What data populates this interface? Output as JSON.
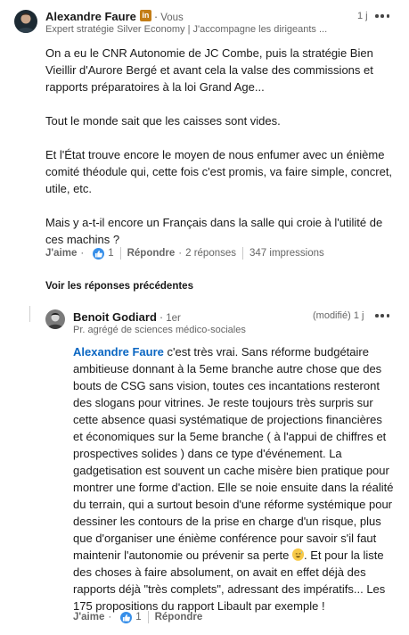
{
  "comment": {
    "author": "Alexandre Faure",
    "badge_letters": "in",
    "relation": "Vous",
    "headline": "Expert stratégie Silver Economy | J'accompagne les dirigeants ...",
    "time": "1 j",
    "paragraphs": [
      "On a eu le CNR Autonomie de JC Combe, puis la stratégie Bien Vieillir d'Aurore Bergé et avant cela la valse des commissions et rapports préparatoires à la loi Grand Age...",
      "Tout le monde sait que les caisses sont vides.",
      "Et l'État trouve encore le moyen de nous enfumer avec un énième comité théodule qui, cette fois c'est promis, va faire simple, concret, utile, etc.",
      "Mais y a-t-il encore un Français dans la salle qui croie à l'utilité de ces machins ?"
    ],
    "like_label": "J'aime",
    "like_count": "1",
    "reply_label": "Répondre",
    "replies_count": "2 réponses",
    "impressions": "347 impressions"
  },
  "previous_replies_label": "Voir les réponses précédentes",
  "reply": {
    "author": "Benoit Godiard",
    "degree": "1er",
    "headline": "Pr. agrégé de sciences médico-sociales",
    "edited": "(modifié)",
    "time": "1 j",
    "mention": "Alexandre Faure",
    "text_main": " c'est très vrai. Sans réforme budgétaire ambitieuse donnant à la 5eme branche autre chose que des bouts de CSG sans vision, toutes ces incantations resteront des slogans pour vitrines. Je reste toujours très surpris sur cette absence quasi systématique de projections financières et économiques sur la 5eme branche ( à l'appui de chiffres et prospectives solides ) dans ce type d'événement. La gadgetisation est souvent un cache misère bien pratique pour montrer une forme d'action. Elle se noie ensuite dans la réalité du terrain, qui a surtout besoin d'une réforme systémique pour dessiner les contours de la prise en charge d'un risque, plus que d'organiser une énième conférence pour savoir s'il faut maintenir l'autonomie ou prévenir sa perte",
    "text_after_emoji": ". Et pour la liste des choses à faire absolument, on avait en effet déjà des rapports déjà \"très complets\", adressant des impératifs... Les 175 propositions du rapport Libault par exemple !",
    "like_label": "J'aime",
    "like_count": "1",
    "reply_label": "Répondre"
  },
  "icons": {
    "more": "ellipsis-icon",
    "like": "thumbs-up-icon",
    "emoji": "sweat-smile-emoji"
  },
  "colors": {
    "accent": "#0a66c2",
    "like": "#378fe9",
    "badge": "#c37d16"
  }
}
